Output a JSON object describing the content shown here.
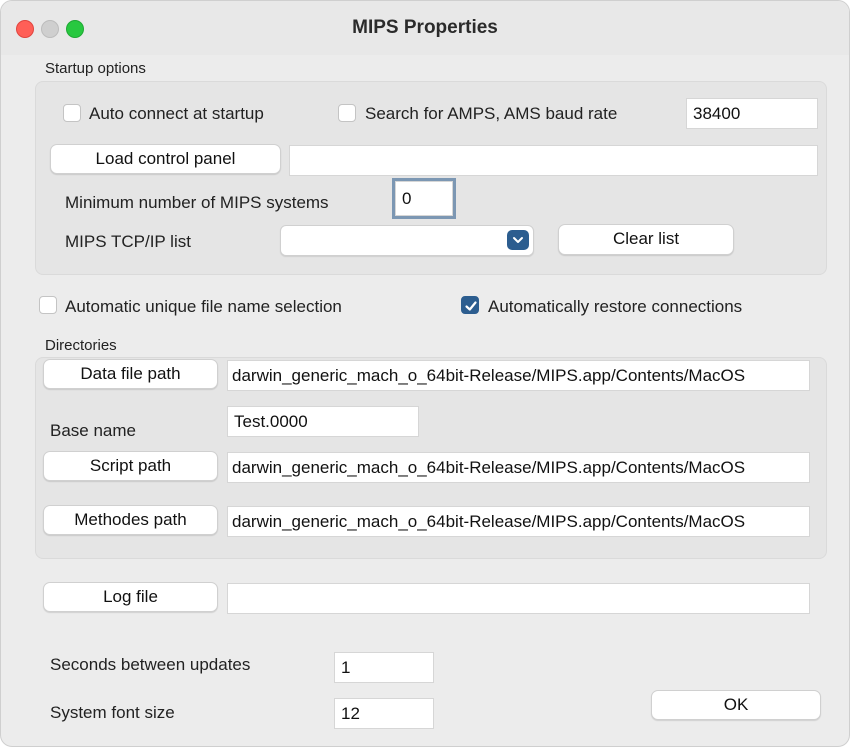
{
  "window": {
    "title": "MIPS Properties"
  },
  "startup": {
    "group_label": "Startup options",
    "auto_connect_label": "Auto connect at startup",
    "auto_connect_checked": false,
    "search_amps_label": "Search for AMPS, AMS baud rate",
    "search_amps_checked": false,
    "baud_rate": "38400",
    "load_control_panel_label": "Load control panel",
    "control_panel_path": "",
    "min_systems_label": "Minimum number of MIPS systems",
    "min_systems_value": "0",
    "tcpip_list_label": "MIPS TCP/IP list",
    "tcpip_selected": "",
    "clear_list_label": "Clear list"
  },
  "options": {
    "auto_unique_label": "Automatic unique file name selection",
    "auto_unique_checked": false,
    "auto_restore_label": "Automatically restore connections",
    "auto_restore_checked": true
  },
  "directories": {
    "group_label": "Directories",
    "data_file_path_label": "Data file path",
    "data_file_path_value": "darwin_generic_mach_o_64bit-Release/MIPS.app/Contents/MacOS",
    "base_name_label": "Base name",
    "base_name_value": "Test.0000",
    "script_path_label": "Script path",
    "script_path_value": "darwin_generic_mach_o_64bit-Release/MIPS.app/Contents/MacOS",
    "methodes_path_label": "Methodes path",
    "methodes_path_value": "darwin_generic_mach_o_64bit-Release/MIPS.app/Contents/MacOS"
  },
  "log": {
    "log_file_label": "Log file",
    "log_file_value": ""
  },
  "settings": {
    "seconds_label": "Seconds between updates",
    "seconds_value": "1",
    "font_size_label": "System font size",
    "font_size_value": "12",
    "ok_label": "OK"
  },
  "colors": {
    "accent": "#2c5d8f",
    "close": "#ff5f57",
    "zoom": "#28c840"
  }
}
